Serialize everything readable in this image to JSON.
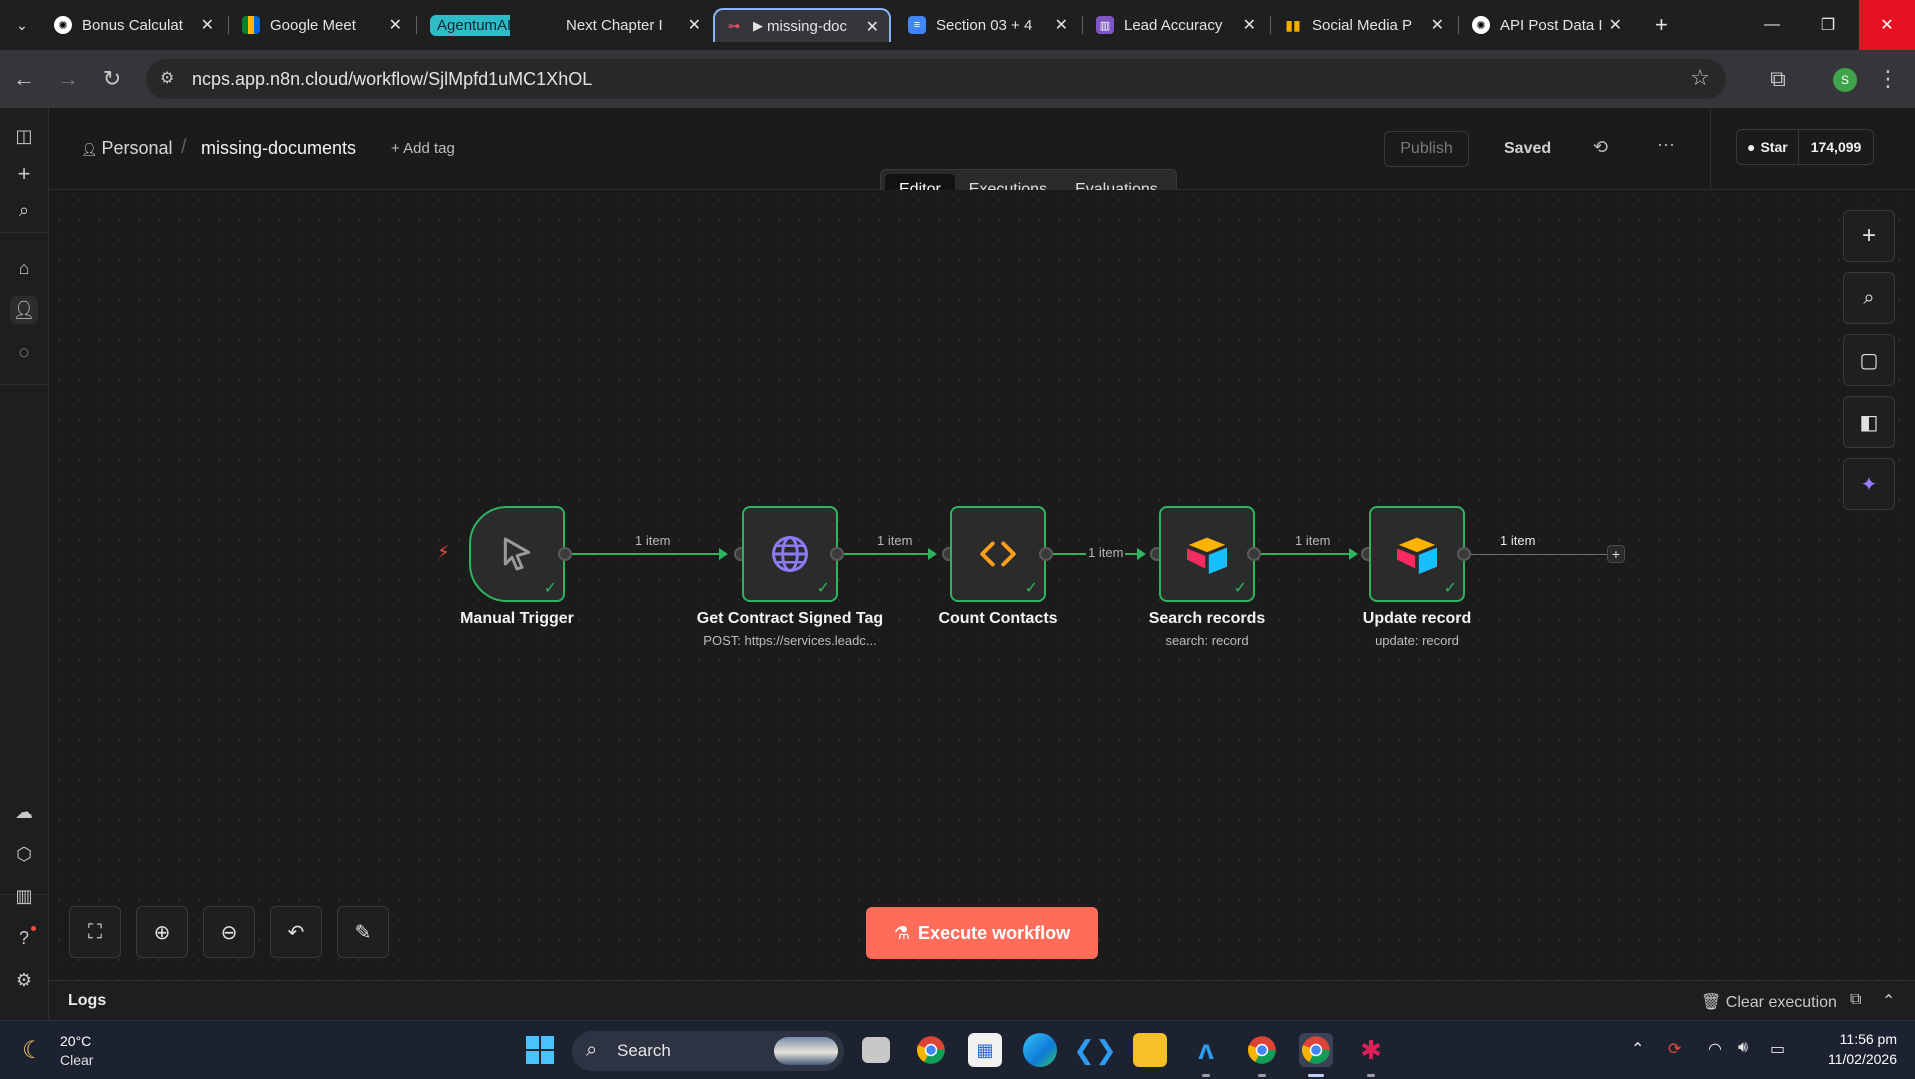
{
  "browser": {
    "tabs": [
      {
        "title": "Bonus Calculat",
        "icon": "openai-icon"
      },
      {
        "title": "Google Meet",
        "icon": "meet-icon"
      },
      {
        "group_label": "AgentumAI",
        "title": "Next Chapter I",
        "icon": "none"
      },
      {
        "title": "missing-doc",
        "icon": "n8n-icon",
        "active": true,
        "playing": "▶"
      },
      {
        "title": "Section 03 + 4",
        "icon": "docs-icon"
      },
      {
        "title": "Lead Accuracy",
        "icon": "forms-icon"
      },
      {
        "title": "Social Media P",
        "icon": "chart-icon"
      },
      {
        "title": "API Post Data I",
        "icon": "openai-icon"
      }
    ],
    "url": "ncps.app.n8n.cloud/workflow/SjlMpfd1uMC1XhOL",
    "profile_initial": "S"
  },
  "header": {
    "project": "Personal",
    "workflow_name": "missing-documents",
    "add_tag": "+ Add tag",
    "publish": "Publish",
    "saved": "Saved",
    "github_star": "Star",
    "github_count": "174,099"
  },
  "view_tabs": [
    "Editor",
    "Executions",
    "Evaluations"
  ],
  "active_view": "Editor",
  "nodes": [
    {
      "title": "Manual Trigger",
      "subtitle": "",
      "icon": "cursor-icon"
    },
    {
      "title": "Get Contract Signed Tag",
      "subtitle": "POST: https://services.leadc...",
      "icon": "globe-icon"
    },
    {
      "title": "Count Contacts",
      "subtitle": "",
      "icon": "code-icon"
    },
    {
      "title": "Search records",
      "subtitle": "search: record",
      "icon": "airtable-icon"
    },
    {
      "title": "Update record",
      "subtitle": "update: record",
      "icon": "airtable-icon"
    }
  ],
  "edges": [
    "1 item",
    "1 item",
    "1 item",
    "1 item",
    "1 item"
  ],
  "execute_button": "Execute workflow",
  "logs": {
    "title": "Logs",
    "clear": "Clear execution"
  },
  "taskbar": {
    "weather_temp": "20°C",
    "weather_desc": "Clear",
    "search_label": "Search",
    "time": "11:56 pm",
    "date": "11/02/2026"
  },
  "colors": {
    "accent": "#ff6d5a",
    "success": "#2fb35f",
    "canvas": "#1b1b1b"
  }
}
